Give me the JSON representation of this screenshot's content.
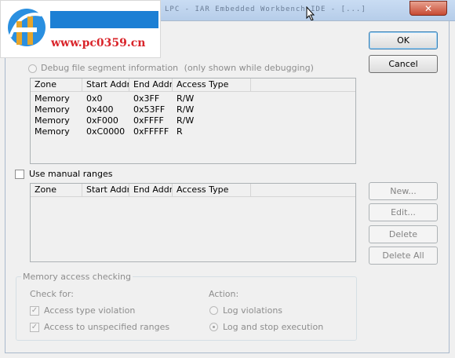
{
  "window": {
    "title": "LPC - IAR Embedded Workbench IDE - [...]",
    "close_label": "✕"
  },
  "watermark": {
    "url_text": "www.pc0359.cn"
  },
  "buttons": {
    "ok": "OK",
    "cancel": "Cancel",
    "new": "New...",
    "edit": "Edit...",
    "delete": "Delete",
    "delete_all": "Delete All"
  },
  "segment_info": {
    "radio_label": "Debug file segment information",
    "radio_note": "(only shown while debugging)",
    "columns": [
      "Zone",
      "Start Addr",
      "End Addr",
      "Access Type"
    ],
    "rows": [
      {
        "zone": "Memory",
        "start": "0x0",
        "end": "0x3FF",
        "access": "R/W"
      },
      {
        "zone": "Memory",
        "start": "0x400",
        "end": "0x53FF",
        "access": "R/W"
      },
      {
        "zone": "Memory",
        "start": "0xF000",
        "end": "0xFFFF",
        "access": "R/W"
      },
      {
        "zone": "Memory",
        "start": "0xC0000",
        "end": "0xFFFFF",
        "access": "R"
      }
    ]
  },
  "manual_ranges": {
    "checkbox_label": "Use manual ranges",
    "checked": false,
    "columns": [
      "Zone",
      "Start Addr",
      "End Addr",
      "Access Type"
    ],
    "rows": []
  },
  "memory_access": {
    "group_title": "Memory access checking",
    "check_for_label": "Check for:",
    "access_type_violation": "Access type violation",
    "access_unspecified": "Access to unspecified ranges",
    "action_label": "Action:",
    "log_violations": "Log violations",
    "log_and_stop": "Log and stop execution"
  }
}
